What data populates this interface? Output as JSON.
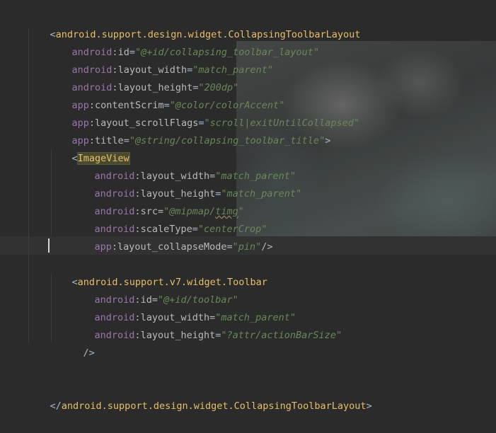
{
  "editor": {
    "lines": [
      {
        "open": "<",
        "tag": "android.support.design.widget.CollapsingToolbarLayout",
        "close": ""
      },
      {
        "ns": "android",
        "attr": "id",
        "value": "@+id/collapsing_toolbar_layout"
      },
      {
        "ns": "android",
        "attr": "layout_width",
        "value": "match_parent"
      },
      {
        "ns": "android",
        "attr": "layout_height",
        "value": "200dp"
      },
      {
        "ns": "app",
        "attr": "contentScrim",
        "value": "@color/colorAccent"
      },
      {
        "ns": "app",
        "attr": "layout_scrollFlags",
        "value": "scroll|exitUntilCollapsed"
      },
      {
        "ns": "app",
        "attr": "title",
        "value": "@string/collapsing_toolbar_title",
        "end": ">"
      },
      {
        "open": "<",
        "tag": "ImageView"
      },
      {
        "ns": "android",
        "attr": "layout_width",
        "value": "match_parent"
      },
      {
        "ns": "android",
        "attr": "layout_height",
        "value": "match_parent"
      },
      {
        "ns": "android",
        "attr": "src",
        "value_prefix": "@mipmap/",
        "value_underlined": "timg"
      },
      {
        "ns": "android",
        "attr": "scaleType",
        "value": "centerCrop"
      },
      {
        "ns": "app",
        "attr": "layout_collapseMode",
        "value": "pin",
        "end": "/>"
      },
      {
        "open": "<",
        "tag": "android.support.v7.widget.Toolbar"
      },
      {
        "ns": "android",
        "attr": "id",
        "value": "@+id/toolbar"
      },
      {
        "ns": "android",
        "attr": "layout_width",
        "value": "match_parent"
      },
      {
        "ns": "android",
        "attr": "layout_height",
        "value": "?attr/actionBarSize"
      },
      {
        "end": "/>"
      },
      {
        "open": "</",
        "tag": "android.support.design.widget.CollapsingToolbarLayout",
        "end": ">"
      }
    ]
  },
  "colors": {
    "background": "#2b2b2b",
    "tag": "#e8bf6a",
    "namespace": "#9876aa",
    "attribute": "#bababa",
    "value": "#6a8759"
  }
}
